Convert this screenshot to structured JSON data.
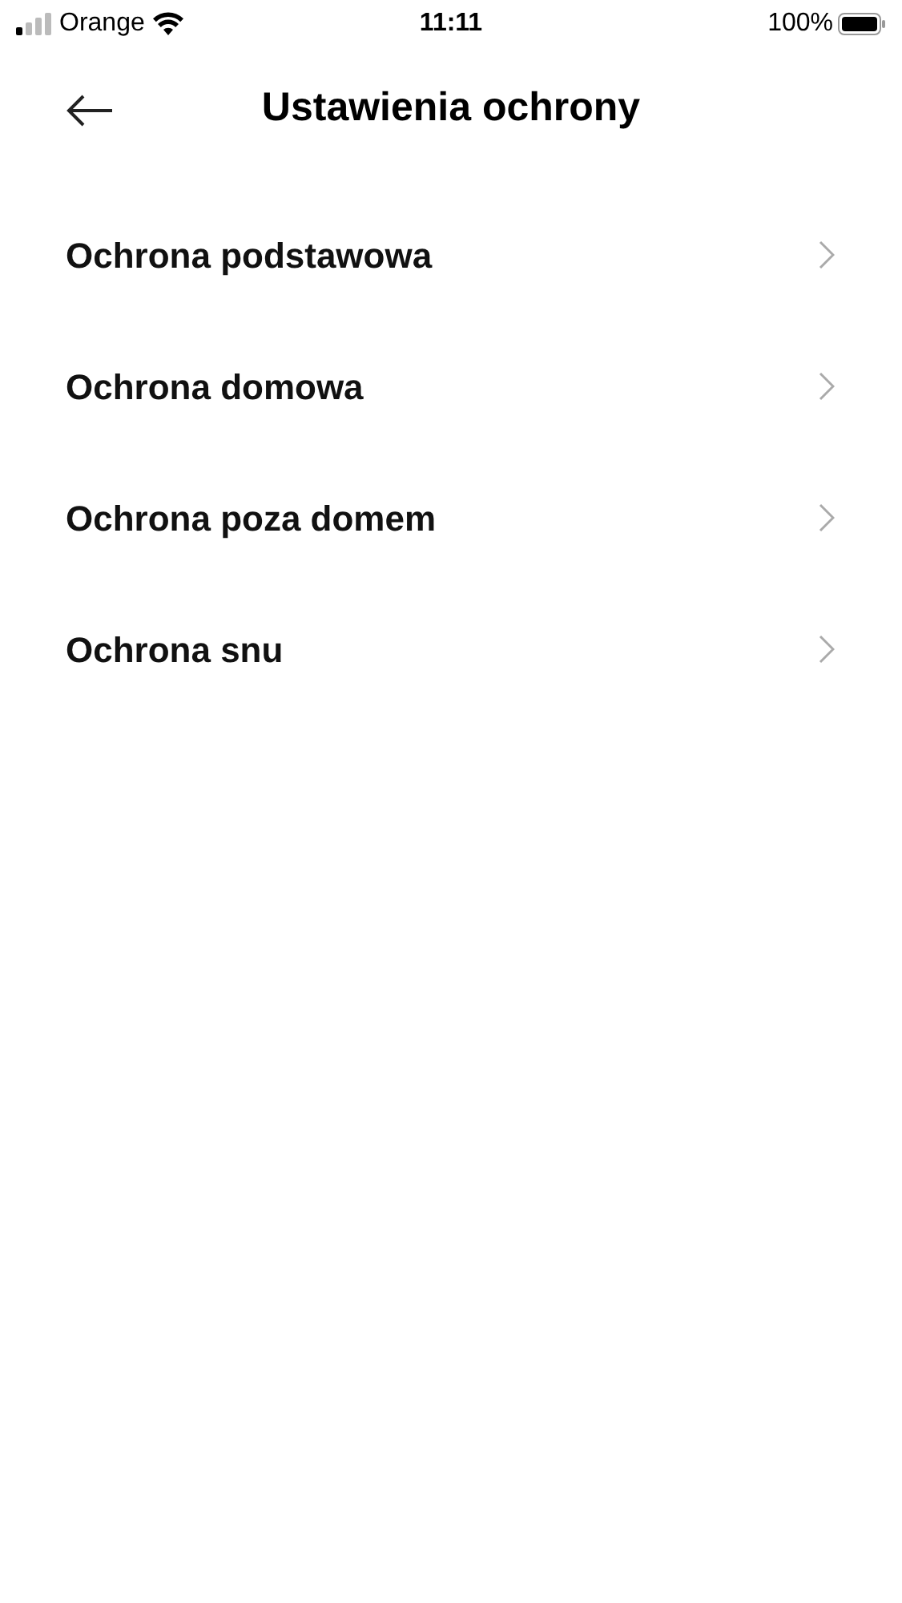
{
  "status_bar": {
    "carrier": "Orange",
    "time": "11:11",
    "battery": "100%"
  },
  "header": {
    "title": "Ustawienia ochrony"
  },
  "items": [
    {
      "label": "Ochrona podstawowa"
    },
    {
      "label": "Ochrona domowa"
    },
    {
      "label": "Ochrona poza domem"
    },
    {
      "label": "Ochrona snu"
    }
  ]
}
